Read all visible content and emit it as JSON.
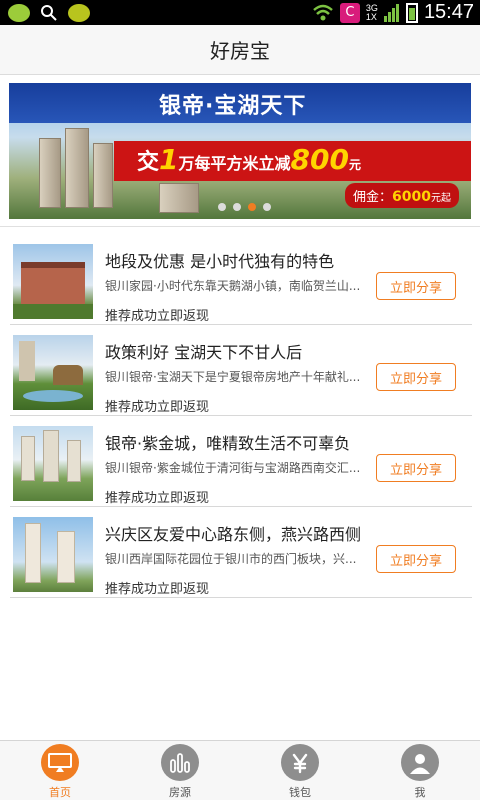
{
  "status_bar": {
    "time": "15:47",
    "network": "3G",
    "network2": "1X",
    "carrier_icon": "C"
  },
  "app": {
    "title": "好房宝"
  },
  "banner": {
    "headline": "银帝·宝湖天下",
    "offer_prefix": "交",
    "offer_num1": "1",
    "offer_mid": "万每平方米立减",
    "offer_num2": "800",
    "offer_unit": "元",
    "commission_label": "佣金：",
    "commission_value": "6000",
    "commission_unit": "元起",
    "slide_count": 4,
    "active_slide": 3
  },
  "listings": [
    {
      "title": "地段及优惠 是小时代独有的特色",
      "desc": "银川家园·小时代东靠天鹅湖小镇，南临贺兰山...",
      "rebate": "推荐成功立即返现",
      "button": "立即分享"
    },
    {
      "title": "政策利好 宝湖天下不甘人后",
      "desc": "银川银帝·宝湖天下是宁夏银帝房地产十年献礼...",
      "rebate": "推荐成功立即返现",
      "button": "立即分享"
    },
    {
      "title": "银帝·紫金城，唯精致生活不可辜负",
      "desc": "银川银帝·紫金城位于清河街与宝湖路西南交汇...",
      "rebate": "推荐成功立即返现",
      "button": "立即分享"
    },
    {
      "title": "兴庆区友爱中心路东侧，燕兴路西侧",
      "desc": "银川西岸国际花园位于银川市的西门板块，兴...",
      "rebate": "推荐成功立即返现",
      "button": "立即分享"
    }
  ],
  "tabs": [
    {
      "label": "首页",
      "icon": "home-screen-icon",
      "active": true
    },
    {
      "label": "房源",
      "icon": "buildings-icon",
      "active": false
    },
    {
      "label": "钱包",
      "icon": "yen-icon",
      "active": false
    },
    {
      "label": "我",
      "icon": "user-icon",
      "active": false
    }
  ],
  "colors": {
    "accent": "#f07d22",
    "banner_red": "#cc1414",
    "banner_blue": "#1f4aa8"
  }
}
